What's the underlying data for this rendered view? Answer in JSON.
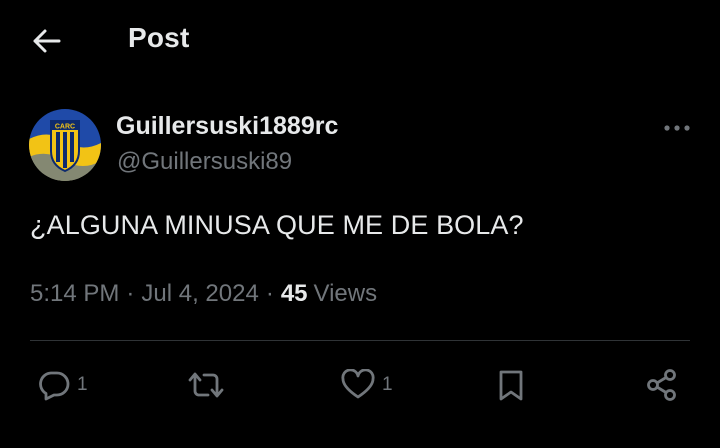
{
  "header": {
    "title": "Post",
    "back_icon": "arrow-left-icon"
  },
  "post": {
    "author": {
      "display_name": "Guillersuski1889rc",
      "handle": "@Guillersuski89",
      "avatar_badge_text": "CARC",
      "avatar_colors": {
        "blue": "#1f4aa8",
        "yellow": "#f2c315"
      }
    },
    "more_icon": "more-horizontal-icon",
    "text": "¿ALGUNA MINUSA QUE ME DE BOLA?",
    "time": "5:14 PM",
    "separator": "·",
    "date": "Jul 4, 2024",
    "views_count": "45",
    "views_label": "Views"
  },
  "actions": {
    "reply": {
      "icon": "reply-bubble-icon",
      "count": "1"
    },
    "repost": {
      "icon": "repost-icon",
      "count": ""
    },
    "like": {
      "icon": "heart-icon",
      "count": "1"
    },
    "bookmark": {
      "icon": "bookmark-icon"
    },
    "share": {
      "icon": "share-icon"
    }
  },
  "colors": {
    "background": "#000000",
    "primary_text": "#e7e9ea",
    "secondary_text": "#71767b",
    "divider": "#2f3336"
  }
}
